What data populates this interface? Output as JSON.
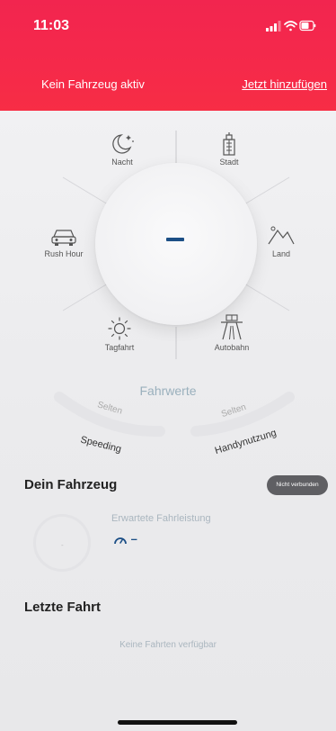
{
  "status_bar": {
    "time": "11:03"
  },
  "header": {
    "title": "Kein Fahrzeug aktiv",
    "link": "Jetzt hinzufügen"
  },
  "wheel": {
    "center_value": "–",
    "categories": [
      {
        "label": "Nacht",
        "icon": "moon-icon"
      },
      {
        "label": "Stadt",
        "icon": "city-icon"
      },
      {
        "label": "Rush Hour",
        "icon": "car-icon"
      },
      {
        "label": "Land",
        "icon": "mountain-icon"
      },
      {
        "label": "Tagfahrt",
        "icon": "sun-icon"
      },
      {
        "label": "Autobahn",
        "icon": "highway-icon"
      }
    ]
  },
  "fahrwerte": {
    "title": "Fahrwerte",
    "speeding": {
      "value": "Selten",
      "label": "Speeding"
    },
    "handy": {
      "value": "Selten",
      "label": "Handynutzung"
    }
  },
  "vehicle": {
    "title": "Dein Fahrzeug",
    "status": "Nicht verbunden",
    "ring_value": "-",
    "expected_label": "Erwartete Fahrleistung",
    "expected_value": "–"
  },
  "last_trip": {
    "title": "Letzte Fahrt",
    "empty": "Keine Fahrten verfügbar"
  },
  "colors": {
    "header": "#f2254f",
    "accent": "#1c4f86",
    "badge": "#5f5f63"
  }
}
